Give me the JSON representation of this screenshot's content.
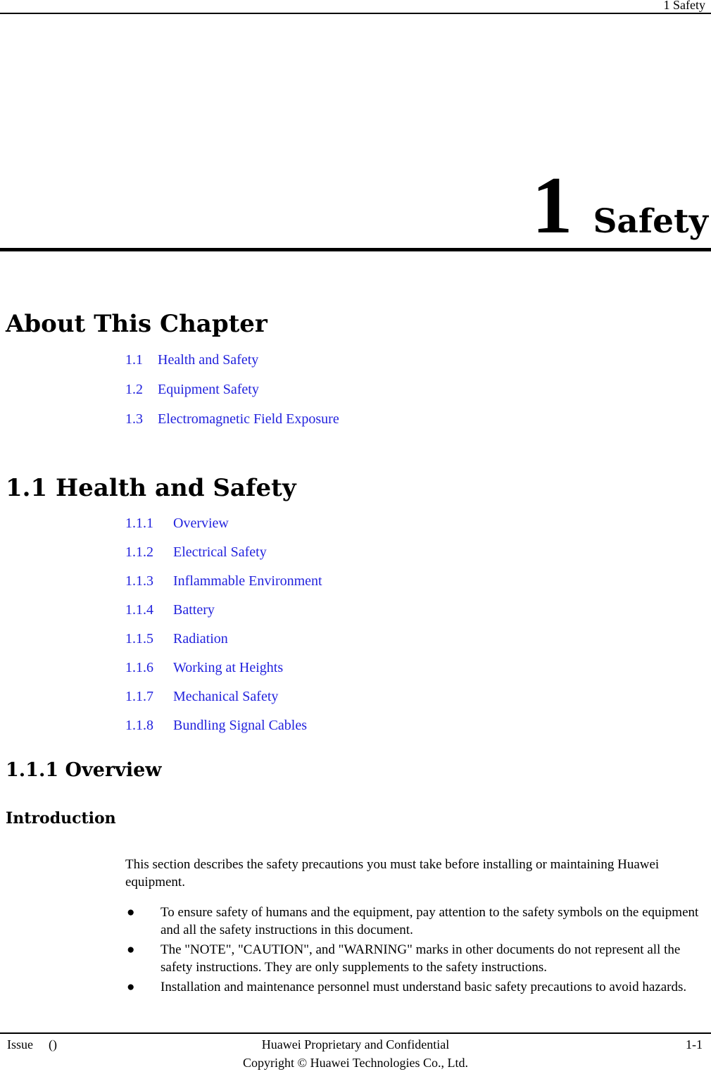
{
  "header": {
    "running_title": "1 Safety"
  },
  "chapter": {
    "number": "1",
    "name": "Safety"
  },
  "about": {
    "heading": "About This Chapter",
    "entries": [
      {
        "number": "1.1",
        "label": "Health and Safety"
      },
      {
        "number": "1.2",
        "label": "Equipment Safety"
      },
      {
        "number": "1.3",
        "label": "Electromagnetic Field Exposure"
      }
    ]
  },
  "section": {
    "heading": "1.1 Health and Safety",
    "entries": [
      {
        "number": "1.1.1",
        "label": "Overview"
      },
      {
        "number": "1.1.2",
        "label": "Electrical Safety"
      },
      {
        "number": "1.1.3",
        "label": "Inflammable Environment"
      },
      {
        "number": "1.1.4",
        "label": "Battery"
      },
      {
        "number": "1.1.5",
        "label": "Radiation"
      },
      {
        "number": "1.1.6",
        "label": "Working at Heights"
      },
      {
        "number": "1.1.7",
        "label": "Mechanical Safety"
      },
      {
        "number": "1.1.8",
        "label": "Bundling Signal Cables"
      }
    ]
  },
  "subsection": {
    "heading": "1.1.1 Overview",
    "para_heading": "Introduction",
    "intro_paragraph": "This section describes the safety precautions you must take before installing or maintaining Huawei equipment.",
    "bullet_marker": "●",
    "bullets": [
      "To ensure safety of humans and the equipment, pay attention to the safety symbols on the equipment and all the safety instructions in this document.",
      "The \"NOTE\", \"CAUTION\", and \"WARNING\" marks in other documents do not represent all the safety instructions. They are only supplements to the safety instructions.",
      "Installation and maintenance personnel must understand basic safety precautions to avoid hazards."
    ]
  },
  "footer": {
    "issue_label": "Issue",
    "issue_value": "()",
    "confidential_line": "Huawei Proprietary and Confidential",
    "copyright_line": "Copyright © Huawei Technologies Co., Ltd.",
    "page_number": "1-1"
  },
  "colors": {
    "link_blue": "#2222DD",
    "text_black": "#000000",
    "page_background": "#FFFFFF"
  }
}
